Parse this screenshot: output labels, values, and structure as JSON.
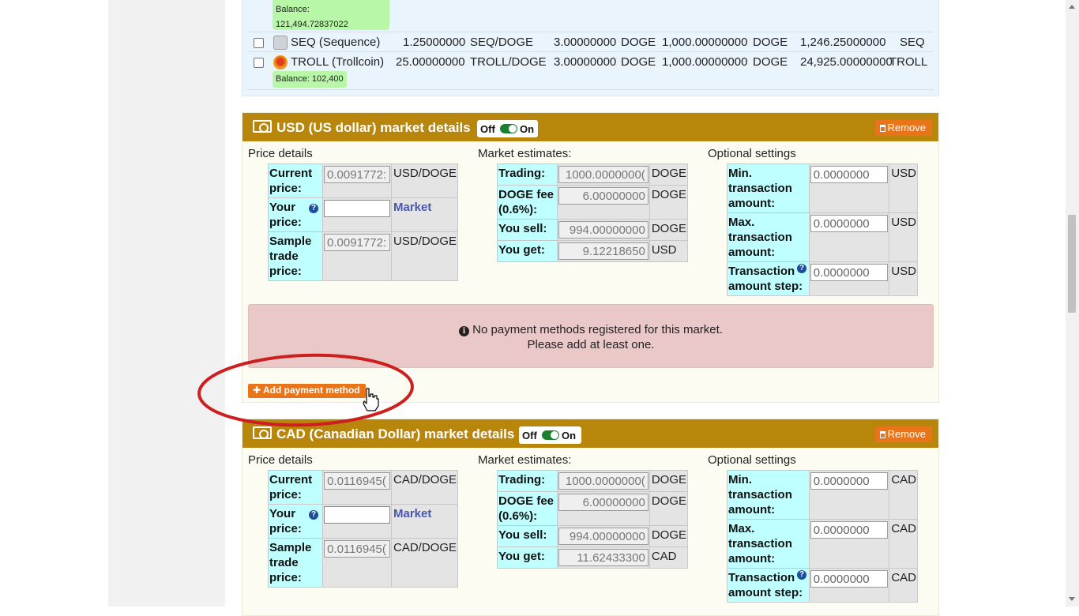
{
  "tokens": {
    "top_balance_label": "Balance:",
    "top_balance_value": "121,494.72837022",
    "rows": [
      {
        "icon": "sequence-coin-icon",
        "name": "SEQ (Sequence)",
        "price": "1.25000000",
        "pair": "SEQ/DOGE",
        "fee": "3.00000000",
        "fee_unit": "DOGE",
        "min": "1,000.00000000",
        "min_unit": "DOGE",
        "amount": "1,246.25000000",
        "amount_unit": "SEQ",
        "balance": ""
      },
      {
        "icon": "trollcoin-icon",
        "name": "TROLL (Trollcoin)",
        "price": "25.00000000",
        "pair": "TROLL/DOGE",
        "fee": "3.00000000",
        "fee_unit": "DOGE",
        "min": "1,000.00000000",
        "min_unit": "DOGE",
        "amount": "24,925.00000000",
        "amount_unit": "TROLL",
        "balance": "Balance: 102,400"
      }
    ]
  },
  "markets": [
    {
      "title": "USD (US dollar) market details",
      "toggle_off": "Off",
      "toggle_on": "On",
      "remove_label": "Remove",
      "price_details": {
        "heading": "Price details",
        "current_price_label": "Current price:",
        "current_price_value": "0.0091772:",
        "current_price_unit": "USD/DOGE",
        "your_price_label": "Your price:",
        "your_price_value": "",
        "market_link": "Market",
        "sample_price_label": "Sample trade price:",
        "sample_price_value": "0.0091772:",
        "sample_price_unit": "USD/DOGE"
      },
      "estimates": {
        "heading": "Market estimates:",
        "trading_label": "Trading:",
        "trading_value": "1000.0000000(",
        "trading_unit": "DOGE",
        "fee_label": "DOGE fee (0.6%):",
        "fee_value": "6.00000000",
        "fee_unit": "DOGE",
        "sell_label": "You sell:",
        "sell_value": "994.00000000",
        "sell_unit": "DOGE",
        "get_label": "You get:",
        "get_value": "9.12218650",
        "get_unit": "USD"
      },
      "optional": {
        "heading": "Optional settings",
        "min_label": "Min. transaction amount:",
        "min_placeholder": "0.0000000",
        "min_unit": "USD",
        "max_label": "Max. transaction amount:",
        "max_placeholder": "0.0000000",
        "max_unit": "USD",
        "step_label": "Transaction amount step:",
        "step_placeholder": "0.0000000",
        "step_unit": "USD"
      },
      "alert_line1": "No payment methods registered for this market.",
      "alert_line2": "Please add at least one.",
      "add_payment_label": "Add payment method"
    },
    {
      "title": "CAD (Canadian Dollar) market details",
      "toggle_off": "Off",
      "toggle_on": "On",
      "remove_label": "Remove",
      "price_details": {
        "heading": "Price details",
        "current_price_label": "Current price:",
        "current_price_value": "0.0116945(",
        "current_price_unit": "CAD/DOGE",
        "your_price_label": "Your price:",
        "your_price_value": "",
        "market_link": "Market",
        "sample_price_label": "Sample trade price:",
        "sample_price_value": "0.0116945(",
        "sample_price_unit": "CAD/DOGE"
      },
      "estimates": {
        "heading": "Market estimates:",
        "trading_label": "Trading:",
        "trading_value": "1000.0000000(",
        "trading_unit": "DOGE",
        "fee_label": "DOGE fee (0.6%):",
        "fee_value": "6.00000000",
        "fee_unit": "DOGE",
        "sell_label": "You sell:",
        "sell_value": "994.00000000",
        "sell_unit": "DOGE",
        "get_label": "You get:",
        "get_value": "11.62433300",
        "get_unit": "CAD"
      },
      "optional": {
        "heading": "Optional settings",
        "min_label": "Min. transaction amount:",
        "min_placeholder": "0.0000000",
        "min_unit": "CAD",
        "max_label": "Max. transaction amount:",
        "max_placeholder": "0.0000000",
        "max_unit": "CAD",
        "step_label": "Transaction amount step:",
        "step_placeholder": "0.0000000",
        "step_unit": "CAD"
      }
    }
  ],
  "colors": {
    "panel_header": "#b8860b",
    "action_button": "#e8751a",
    "label_cell": "#bfffff",
    "alert_bg": "#ebc8c8",
    "annotation_ellipse": "#cc1f1f"
  }
}
